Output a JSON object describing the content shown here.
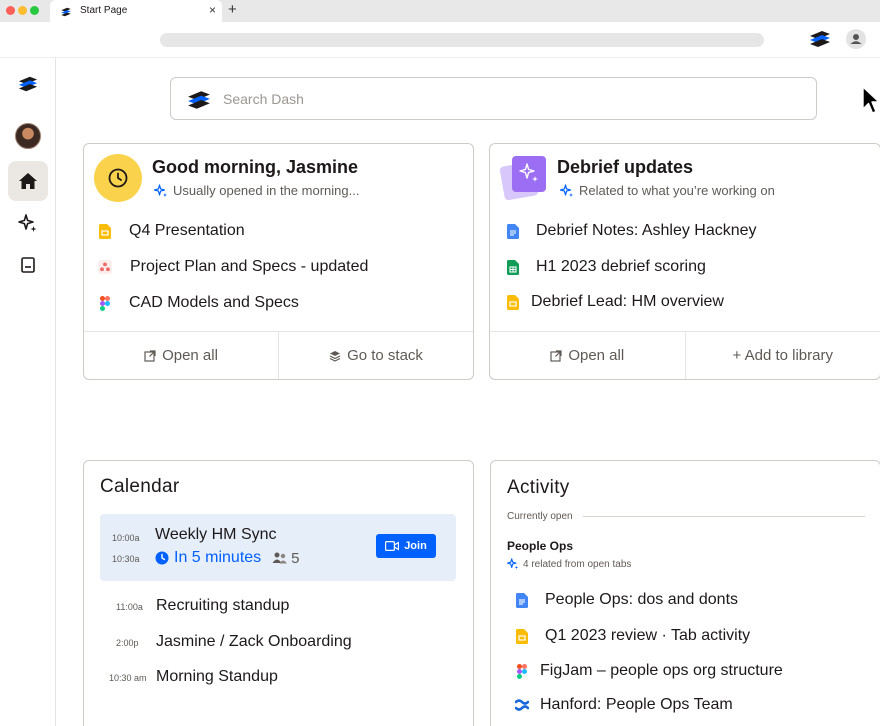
{
  "browser": {
    "tab_title": "Start Page",
    "tab_close": "×",
    "new_tab": "+"
  },
  "search": {
    "placeholder": "Search Dash"
  },
  "morning_card": {
    "title": "Good morning, Jasmine",
    "subtitle": "Usually opened in the morning...",
    "items": [
      {
        "label": "Q4 Presentation",
        "icon": "google-slides-icon"
      },
      {
        "label": "Project Plan and Specs - updated",
        "icon": "asana-icon"
      },
      {
        "label": "CAD Models and Specs",
        "icon": "figma-icon"
      }
    ],
    "footer": {
      "open_all": "Open all",
      "go_to_stack": "Go to stack"
    }
  },
  "debrief_card": {
    "title": "Debrief updates",
    "subtitle": "Related to what you’re working on",
    "items": [
      {
        "label": "Debrief Notes: Ashley Hackney",
        "icon": "google-docs-icon"
      },
      {
        "label": "H1 2023 debrief scoring",
        "icon": "google-sheets-icon"
      },
      {
        "label": "Debrief Lead: HM overview",
        "icon": "google-slides-icon"
      }
    ],
    "footer": {
      "open_all": "Open all",
      "add_to_library": "+ Add to library"
    }
  },
  "calendar": {
    "title": "Calendar",
    "highlight_event": {
      "start": "10:00a",
      "end": "10:30a",
      "title": "Weekly HM Sync",
      "status": "In 5 minutes",
      "attendees": "5",
      "join_label": "Join"
    },
    "events": [
      {
        "time": "11:00a",
        "title": "Recruiting standup"
      },
      {
        "time": "2:00p",
        "title": "Jasmine / Zack Onboarding"
      },
      {
        "time": "10:30 am",
        "title": "Morning Standup"
      }
    ]
  },
  "activity": {
    "title": "Activity",
    "divider_label": "Currently open",
    "group_title": "People Ops",
    "group_sub": "4 related from open tabs",
    "items": [
      {
        "label": "People Ops: dos and donts",
        "icon": "google-docs-icon"
      },
      {
        "label": "Q1 2023 review · Tab activity",
        "icon": "google-slides-icon"
      },
      {
        "label": "FigJam – people ops org structure",
        "icon": "figma-icon"
      },
      {
        "label": "Hanford: People Ops Team",
        "icon": "confluence-icon"
      }
    ]
  },
  "colors": {
    "accent_blue": "#0061fe",
    "clock_yellow": "#fad24b",
    "debrief_purple": "#9b6ef3",
    "highlight_bg": "#e6eef9"
  }
}
